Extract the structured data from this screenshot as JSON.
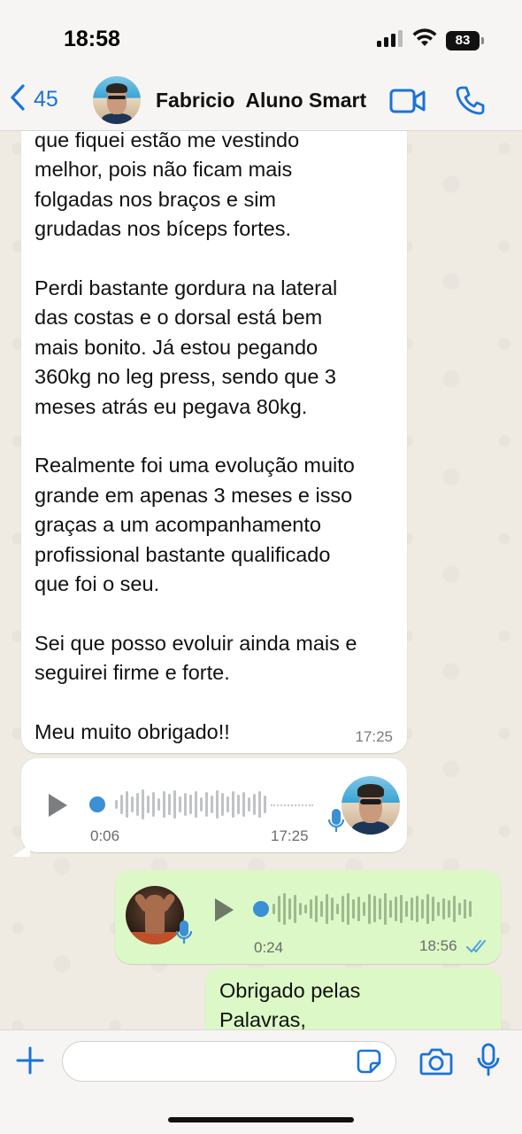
{
  "status_bar": {
    "time": "18:58",
    "battery": "83",
    "icons": [
      "signal-icon",
      "wifi-icon",
      "battery-icon"
    ]
  },
  "header": {
    "back_count": "45",
    "contact_name": "Fabricio  Aluno Smart",
    "icons": [
      "back-chevron-icon",
      "video-call-icon",
      "phone-icon"
    ],
    "accent_color": "#1a73d9"
  },
  "messages": [
    {
      "type": "text",
      "direction": "incoming",
      "text": "que fiquei estão me vestindo\nmelhor, pois não ficam mais\nfolgadas nos braços e sim\ngrudadas nos bíceps fortes.\n\nPerdi bastante gordura na lateral\ndas costas e o dorsal está bem\nmais bonito. Já estou pegando\n360kg no leg press, sendo que 3\nmeses atrás eu pegava 80kg.\n\nRealmente foi uma evolução muito\ngrande em apenas 3 meses e isso\ngraças a um acompanhamento\nprofissional bastante qualificado\nque foi o seu.\n\nSei que posso evoluir ainda mais e\nseguirei firme e forte.\n\nMeu muito obrigado!!",
      "time": "17:25"
    },
    {
      "type": "voice",
      "direction": "incoming",
      "duration": "0:06",
      "time": "17:25",
      "progress": 0
    },
    {
      "type": "voice",
      "direction": "outgoing",
      "duration": "0:24",
      "time": "18:56",
      "status": "read",
      "progress": 0
    },
    {
      "type": "text",
      "direction": "outgoing",
      "text": "Obrigado pelas\nPalavras,"
    }
  ],
  "input_bar": {
    "placeholder": "",
    "icons": [
      "plus-icon",
      "sticker-icon",
      "camera-icon",
      "microphone-icon"
    ]
  },
  "colors": {
    "incoming_bubble": "#ffffff",
    "outgoing_bubble": "#dcf8c6",
    "chat_background": "#efeae2",
    "read_ticks": "#4fa3e0"
  }
}
